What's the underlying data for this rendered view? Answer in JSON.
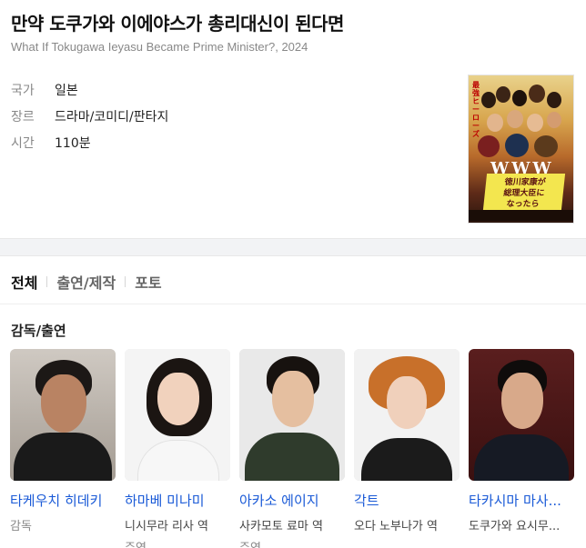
{
  "movie": {
    "title": "만약 도쿠가와 이에야스가 총리대신이 된다면",
    "original_title": "What If Tokugawa Ieyasu Became Prime Minister?, 2024",
    "info": [
      {
        "label": "국가",
        "value": "일본"
      },
      {
        "label": "장르",
        "value": "드라마/코미디/판타지"
      },
      {
        "label": "시간",
        "value": "110분"
      }
    ]
  },
  "tabs": [
    {
      "label": "전체",
      "active": true
    },
    {
      "label": "출연/제작",
      "active": false
    },
    {
      "label": "포토",
      "active": false
    }
  ],
  "section": {
    "title": "감독/출연"
  },
  "cast": [
    {
      "name": "타케우치 히데키",
      "role": "감독",
      "role_muted": true,
      "role2": ""
    },
    {
      "name": "하마베 미나미",
      "role": "니시무라 리사 역",
      "role_muted": false,
      "role2": "주연"
    },
    {
      "name": "아카소 에이지",
      "role": "사카모토 료마 역",
      "role_muted": false,
      "role2": "주연"
    },
    {
      "name": "각트",
      "role": "오다 노부나가 역",
      "role_muted": false,
      "role2": ""
    },
    {
      "name": "타카시마 마사...",
      "role": "도쿠가와 요시무...",
      "role_muted": false,
      "role2": ""
    }
  ],
  "colors": {
    "link": "#1a5ad7",
    "muted": "#888888",
    "divider": "#f2f3f5"
  }
}
